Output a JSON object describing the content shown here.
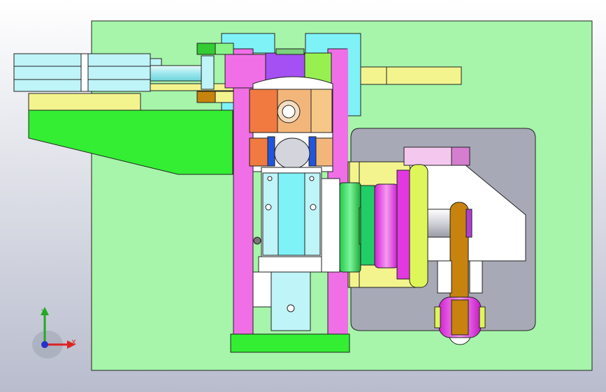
{
  "viewport": {
    "background_top": "#ffffff",
    "background_bottom": "#b8bccd"
  },
  "colors": {
    "base_plate": "#a6f5aa",
    "magenta": "#f06fe7",
    "cyan": "#7ff2f8",
    "light_cyan": "#bff4f8",
    "yellow": "#f4f48f",
    "green": "#33ee33",
    "purple": "#a450f3",
    "orange": "#f07a3f",
    "light_orange": "#f3b67a",
    "gold": "#c7830d",
    "grey_pocket": "#a8a9b6",
    "white": "#ffffff",
    "pink_light": "#f4c8ee",
    "yellow_green": "#dff65a"
  },
  "triad": {
    "axis_y": "Y",
    "axis_x": "X",
    "y_color": "#22aa22",
    "x_color": "#dd2222",
    "z_color": "#2233cc"
  }
}
